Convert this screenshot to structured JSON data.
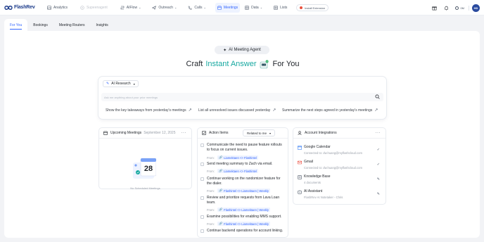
{
  "brand": {
    "name": "FlashRev"
  },
  "nav": [
    {
      "label": "Analytics",
      "icon": "analytics-icon",
      "state": "normal"
    },
    {
      "label": "Supeenagent",
      "icon": "agent-icon",
      "state": "dim"
    },
    {
      "label": "AIFlow",
      "icon": "aiflow-icon",
      "state": "normal",
      "chevron": "⌄"
    },
    {
      "label": "Outreach",
      "icon": "outreach-icon",
      "state": "normal",
      "chevron": "⌄"
    },
    {
      "label": "Calls",
      "icon": "phone-icon",
      "state": "normal",
      "chevron": "⌄"
    },
    {
      "label": "Meetings",
      "icon": "meetings-icon",
      "state": "active"
    },
    {
      "label": "Data",
      "icon": "data-icon",
      "state": "normal",
      "chevron": "⌄"
    },
    {
      "label": "Lists",
      "icon": "lists-icon",
      "state": "normal"
    }
  ],
  "extension_button": "Install Extension",
  "user": {
    "credits": "0M",
    "avatar": "HD"
  },
  "tabs": [
    {
      "label": "For You",
      "active": true
    },
    {
      "label": "Bookings",
      "active": false
    },
    {
      "label": "Meeting Routers",
      "active": false
    },
    {
      "label": "Insights",
      "active": false
    }
  ],
  "agent_pill": "AI Meeting Agent",
  "hero": {
    "prefix": "Craft",
    "accent": "Instant Answer",
    "suffix": "For You"
  },
  "search": {
    "mode_label": "AI Research",
    "placeholder": "Ask me anything about your prior meetings",
    "suggestions": [
      "Show the key takeaways from yesterday's meetings",
      "List all unresolved issues discussed yesterday",
      "Summarize the next steps agreed in yesterday's meetings"
    ]
  },
  "upcoming": {
    "title": "Upcoming Meetings",
    "date": "September 12, 2025",
    "calendar_day": "28",
    "empty_text": "No Scheduled Meetings",
    "more": "···"
  },
  "action_items": {
    "title": "Action Items",
    "filter": "Related to me",
    "from_label": "From:",
    "items": [
      {
        "text": "Communicate the need to pause feature rollouts to focus on current issues.",
        "from": "Liamektaen <> Flashintel"
      },
      {
        "text": "Send meeting summary to Zach via email.",
        "from": "Liamektaen <> Flashintel"
      },
      {
        "text": "Continue working on the randomizer feature for the dialer.",
        "from": "Flashintel <> Liamektaen | Weekly"
      },
      {
        "text": "Review and prioritize requests from Lava Loan team.",
        "from": "Flashintel <> Liamektaen | Weekly"
      },
      {
        "text": "Examine possibilities for enabling MMS support.",
        "from": "Flashintel <> Liamektaen | Weekly"
      },
      {
        "text": "Continue backend operations for account linking."
      }
    ]
  },
  "integrations": {
    "title": "Account Integrations",
    "more": "···",
    "items": [
      {
        "name": "Google Calendar",
        "sub": "Connected to: dw.huang@myflashcloud.com",
        "status": "✓",
        "icon": "google-calendar-icon",
        "color": "#4285f4"
      },
      {
        "name": "Gmail",
        "sub": "Connected to: dw.huang@myflashcloud.com",
        "status": "✓",
        "icon": "gmail-icon",
        "color": "#ea4335"
      },
      {
        "name": "Knowledge Base",
        "sub": "4 documents",
        "status": "✎",
        "icon": "knowledge-base-icon",
        "color": "#4e5969"
      },
      {
        "name": "AI Assistant",
        "sub": "FlashRev AI Notetaker - Chris",
        "status": "✎",
        "icon": "ai-assistant-icon",
        "color": "#4e5969"
      }
    ]
  },
  "colors": {
    "accent": "#3366ff",
    "teal": "#16a8a0",
    "brand_navy": "#1f3e8c"
  }
}
